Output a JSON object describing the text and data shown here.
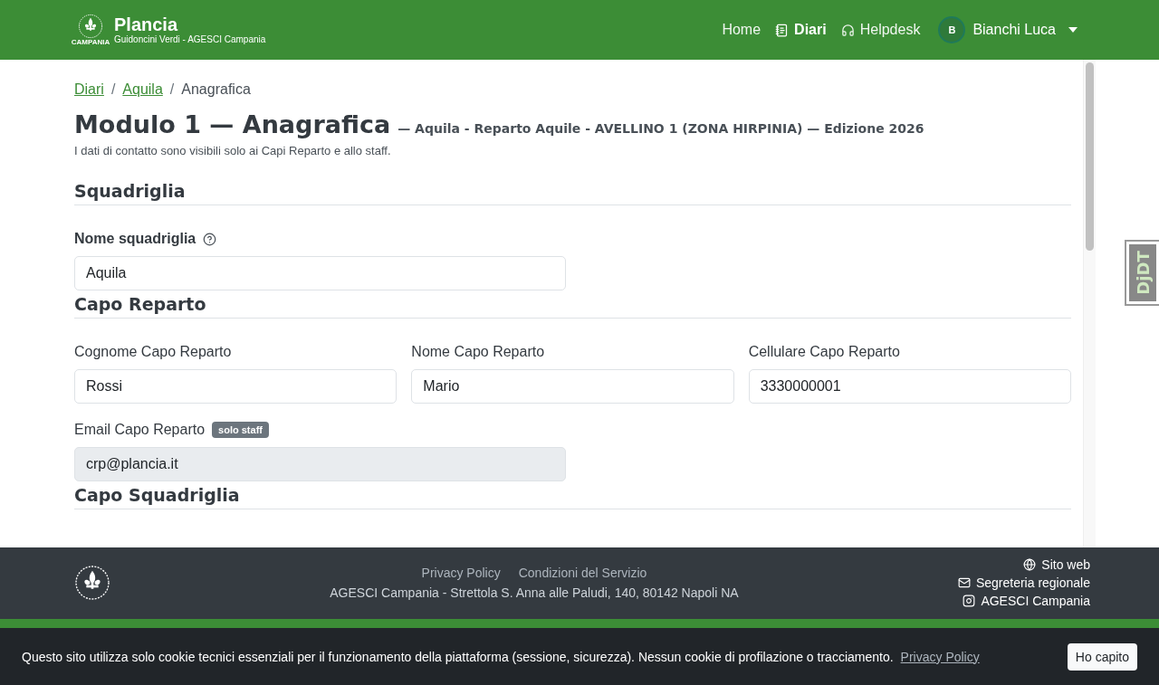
{
  "header": {
    "brand": "Plancia",
    "subtitle": "Guidoncini Verdi - AGESCI Campania",
    "logo_caption": "CAMPANIA",
    "nav": [
      {
        "label": "Home",
        "selected": false
      },
      {
        "label": "Diari",
        "selected": true
      },
      {
        "label": "Helpdesk",
        "selected": false
      }
    ],
    "user": {
      "initial": "B",
      "name": "Bianchi Luca"
    }
  },
  "breadcrumb": [
    {
      "label": "Diari",
      "link": true
    },
    {
      "label": "Aquila",
      "link": true
    },
    {
      "label": "Anagrafica",
      "link": false
    }
  ],
  "breadcrumb_separator": "/",
  "page": {
    "title": "Modulo 1 — Anagrafica",
    "subtitle": "— Aquila - Reparto Aquile - AVELLINO 1 (ZONA HIRPINIA) — Edizione 2026",
    "note": "I dati di contatto sono visibili solo ai Capi Reparto e allo staff."
  },
  "sections": [
    {
      "title": "Squadriglia",
      "rows": [
        [
          {
            "label": "Nome squadriglia",
            "help": true,
            "value": "Aquila",
            "disabled": false
          }
        ]
      ]
    },
    {
      "title": "Capo Reparto",
      "rows": [
        [
          {
            "label": "Cognome Capo Reparto",
            "help": false,
            "value": "Rossi",
            "disabled": false
          },
          {
            "label": "Nome Capo Reparto",
            "help": false,
            "value": "Mario",
            "disabled": false
          },
          {
            "label": "Cellulare Capo Reparto",
            "help": false,
            "value": "3330000001",
            "disabled": false
          }
        ],
        [
          {
            "label": "Email Capo Reparto",
            "help": false,
            "badge": "solo staff",
            "value": "crp@plancia.it",
            "disabled": true
          }
        ]
      ]
    },
    {
      "title": "Capo Squadriglia"
    }
  ],
  "footer": {
    "links": [
      "Privacy Policy",
      "Condizioni del Servizio"
    ],
    "address": "AGESCI Campania - Strettola S. Anna alle Paludi, 140, 80142 Napoli NA",
    "contacts": [
      {
        "label": "Sito web"
      },
      {
        "label": "Segreteria regionale"
      },
      {
        "label": "AGESCI Campania"
      }
    ]
  },
  "cookie_banner": {
    "message": "Questo sito utilizza solo cookie tecnici essenziali per il funzionamento della piattaforma (sessione, sicurezza). Nessun cookie di profilazione o tracciamento.",
    "link": "Privacy Policy",
    "button": "Ho capito"
  },
  "debug_toolbar": {
    "label": "DjDT"
  }
}
